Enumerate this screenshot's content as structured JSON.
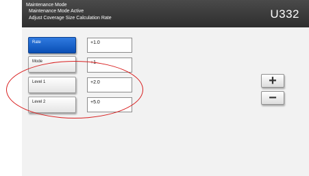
{
  "header": {
    "line1": "Maintenance Mode",
    "line2": "Maintenance Mode Active",
    "line3": "Adjust Coverage Size Calculation Rate",
    "code": "U332"
  },
  "rows": [
    {
      "label": "Rate",
      "value": "+1.0",
      "active": true
    },
    {
      "label": "Mode",
      "value": "+1",
      "active": false
    },
    {
      "label": "Level 1",
      "value": "+2.0",
      "active": false
    },
    {
      "label": "Level 2",
      "value": "+5.0",
      "active": false
    }
  ],
  "controls": {
    "plus": "+",
    "minus": "−"
  },
  "colors": {
    "active_button": "#1562cc",
    "annotation": "#d81c1c",
    "header": "#3a3a3a"
  }
}
